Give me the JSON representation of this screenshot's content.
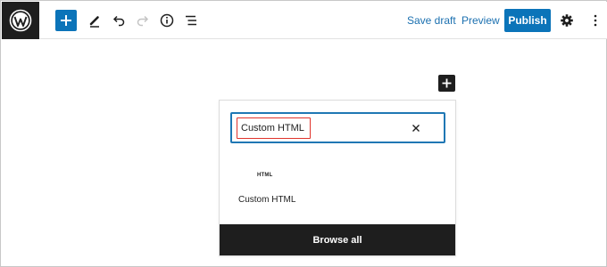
{
  "toolbar": {
    "logo_icon": "wordpress-logo-icon",
    "add_block_icon": "plus-icon",
    "tools_icon": "pencil-icon",
    "undo_icon": "undo-icon",
    "redo_icon": "redo-icon",
    "details_icon": "info-icon",
    "list_view_icon": "list-view-icon",
    "save_draft_label": "Save draft",
    "preview_label": "Preview",
    "publish_label": "Publish",
    "settings_icon": "gear-icon",
    "options_icon": "more-vertical-icon"
  },
  "canvas": {
    "add_block_icon": "plus-icon"
  },
  "inserter": {
    "search_value": "Custom HTML",
    "clear_icon": "close-icon",
    "results": [
      {
        "icon_text": "HTML",
        "label": "Custom HTML"
      }
    ],
    "browse_all_label": "Browse all"
  },
  "colors": {
    "accent": "#0b74b9",
    "dark": "#1e1e1e",
    "highlight": "#e0332b"
  }
}
